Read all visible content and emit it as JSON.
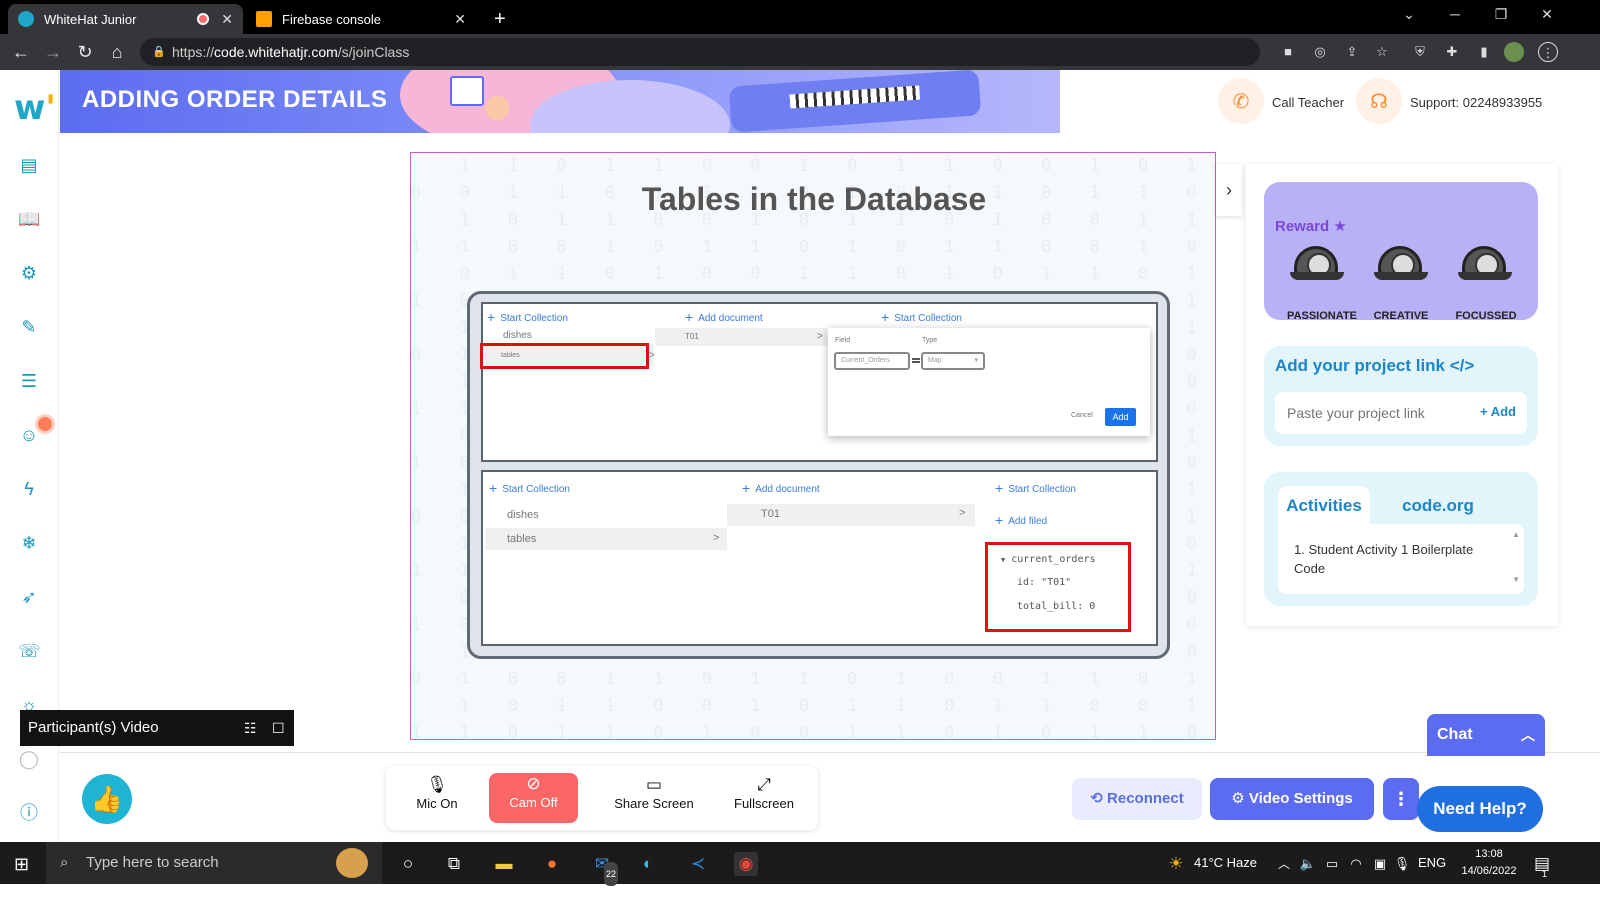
{
  "browser": {
    "tabs": [
      {
        "title": "WhiteHat Junior",
        "active": true
      },
      {
        "title": "Firebase console",
        "active": false
      }
    ],
    "new_tab": "+",
    "url_prefix": "https://",
    "url_host": "code.whitehatjr.com",
    "url_path": "/s/joinClass"
  },
  "banner": {
    "title": "ADDING ORDER DETAILS"
  },
  "header": {
    "call_teacher": "Call Teacher",
    "support": "Support: 02248933955"
  },
  "slide": {
    "title": "Tables in the Database",
    "top_panel": {
      "start_collection": "Start Collection",
      "add_document": "Add document",
      "start_collection_2": "Start Collection",
      "collections": [
        "dishes",
        "tables"
      ],
      "document": "T01",
      "field_label": "Field",
      "type_label": "Type",
      "field_value": "Current_Orders",
      "type_value": "Map",
      "cancel": "Cancel",
      "add": "Add"
    },
    "bottom_panel": {
      "start_collection": "Start Collection",
      "add_document": "Add document",
      "start_collection_2": "Start Collection",
      "add_field": "Add filed",
      "collections": [
        "dishes",
        "tables"
      ],
      "document": "T01",
      "map_name": "current_orders",
      "field_id": "id: \"T01\"",
      "field_total": "total_bill: 0"
    }
  },
  "right_panel": {
    "reward_title": "Reward",
    "badges": [
      "PASSIONATE",
      "CREATIVE",
      "FOCUSSED"
    ],
    "project_link_title": "Add your project link </>",
    "project_link_placeholder": "Paste your project link",
    "project_link_add": "+ Add",
    "tabs": [
      "Activities",
      "code.org"
    ],
    "activity_item": "1. Student Activity 1 Boilerplate Code"
  },
  "bottom": {
    "participants": "Participant(s) Video",
    "mic": "Mic On",
    "cam": "Cam Off",
    "share": "Share Screen",
    "fullscreen": "Fullscreen",
    "reconnect": "Reconnect",
    "video_settings": "Video Settings",
    "chat": "Chat",
    "need_help": "Need Help?"
  },
  "taskbar": {
    "search_placeholder": "Type here to search",
    "weather": "41°C  Haze",
    "language": "ENG",
    "time": "13:08",
    "date": "14/06/2022",
    "mail_badge": "22",
    "notification_count": "1"
  },
  "colors": {
    "accent": "#5c6cf0",
    "teal": "#1b97b8",
    "reward": "#b9b1f5",
    "cam_off": "#fb6667",
    "highlight_box": "#e01010"
  }
}
